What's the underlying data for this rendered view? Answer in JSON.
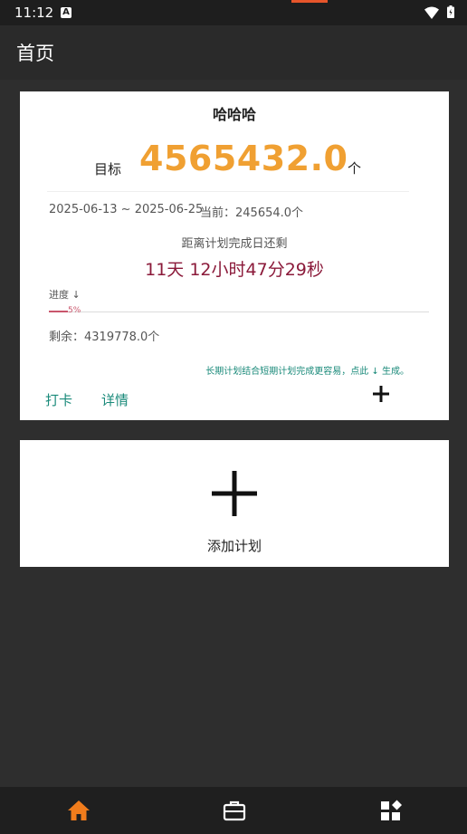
{
  "status_bar": {
    "time": "11:12",
    "notification_icon": "a-icon"
  },
  "app_bar": {
    "title": "首页"
  },
  "plan_card": {
    "name": "哈哈哈",
    "goal_label": "目标",
    "goal_value": "4565432.0",
    "goal_unit": "个",
    "date_range": "2025-06-13 ~ 2025-06-25",
    "current": "当前：245654.0个",
    "remaining_time_label": "距离计划完成日还剩",
    "countdown": "11天  12小时47分29秒",
    "progress_label": "进度 ↓",
    "progress_percent": "5%",
    "progress_value": 0.05,
    "remaining": "剩余：4319778.0个",
    "tip": "长期计划结合短期计划完成更容易，点此 ↓ 生成。",
    "checkin_label": "打卡",
    "details_label": "详情"
  },
  "add_plan": {
    "label": "添加计划"
  },
  "bottom_nav": {
    "items": [
      "home-icon",
      "briefcase-icon",
      "widgets-icon"
    ],
    "active_color": "#f07c1c"
  },
  "colors": {
    "goal_value": "#f0a032",
    "countdown": "#8b1a3a",
    "accent": "#1a8a7a",
    "progress": "#c9566c"
  }
}
